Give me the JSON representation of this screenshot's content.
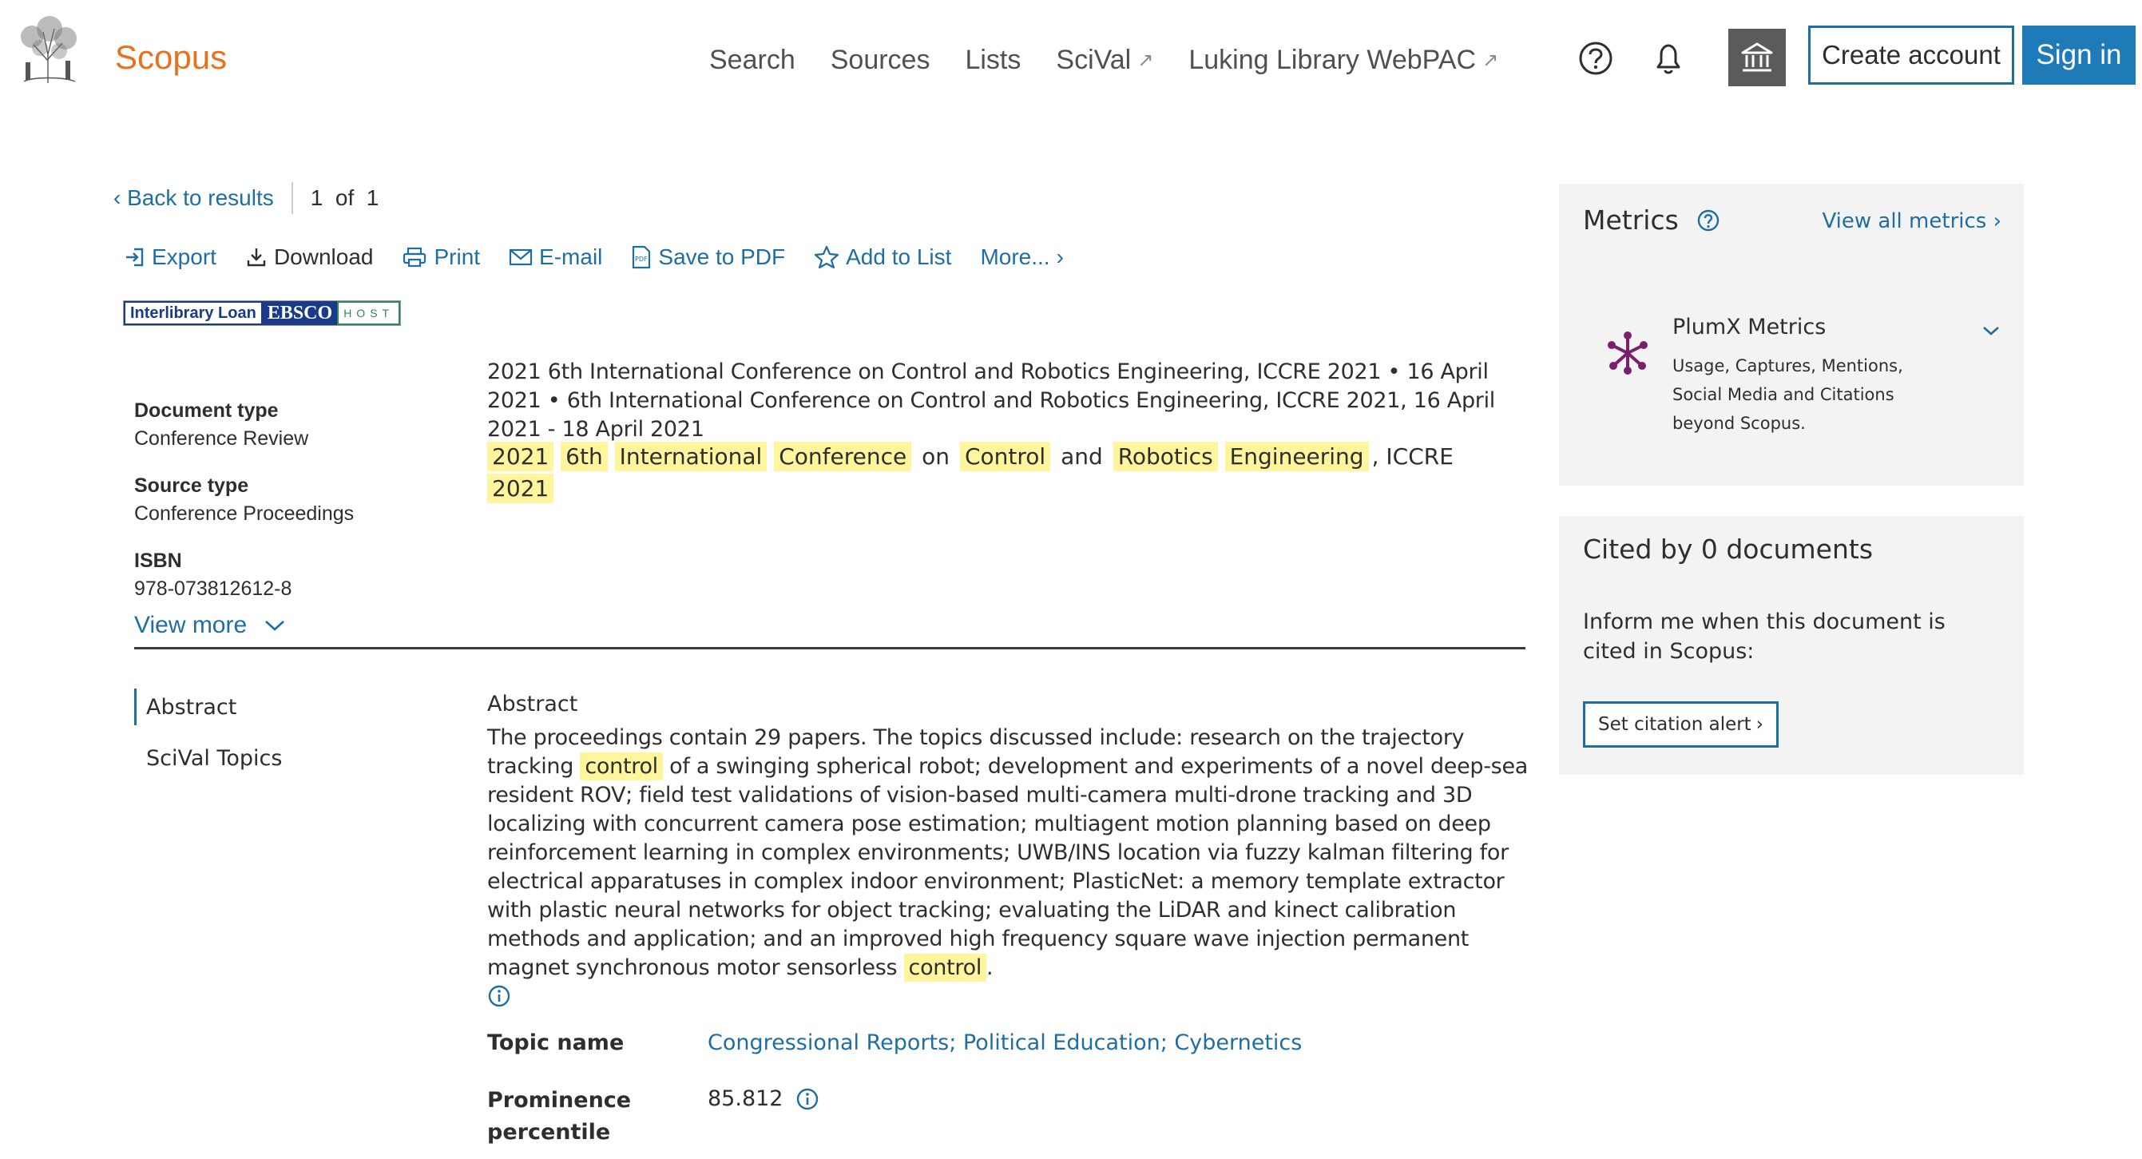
{
  "header": {
    "brand": "Scopus",
    "nav": [
      {
        "label": "Search",
        "external": false
      },
      {
        "label": "Sources",
        "external": false
      },
      {
        "label": "Lists",
        "external": false
      },
      {
        "label": "SciVal",
        "external": true
      },
      {
        "label": "Luking Library WebPAC",
        "external": true
      }
    ],
    "create_account": "Create account",
    "sign_in": "Sign in",
    "icons": [
      "help-icon",
      "bell-icon",
      "institution-icon"
    ]
  },
  "results_nav": {
    "back": "Back to results",
    "position": "1  of  1"
  },
  "actions": {
    "export": "Export",
    "download": "Download",
    "print": "Print",
    "email": "E-mail",
    "save_pdf": "Save to PDF",
    "add_list": "Add to List",
    "more": "More..."
  },
  "links": {
    "interlibrary": "Interlibrary Loan",
    "ebsco": "EBSCO",
    "host": "HOST"
  },
  "meta": {
    "doc_type_label": "Document type",
    "doc_type": "Conference Review",
    "source_type_label": "Source type",
    "source_type": "Conference Proceedings",
    "isbn_label": "ISBN",
    "isbn": "978-073812612-8",
    "view_more": "View more"
  },
  "source": {
    "line": "2021 6th International Conference on Control and Robotics Engineering, ICCRE 2021  •  16 April 2021  •  6th International Conference on Control and Robotics Engineering, ICCRE 2021, 16 April 2021 - 18 April 2021",
    "title_tokens": [
      {
        "t": "2021",
        "hl": true
      },
      {
        "t": "6th",
        "hl": true
      },
      {
        "t": "International",
        "hl": true
      },
      {
        "t": "Conference",
        "hl": true
      },
      {
        "t": "on",
        "hl": false
      },
      {
        "t": "Control",
        "hl": true
      },
      {
        "t": "and",
        "hl": false
      },
      {
        "t": "Robotics",
        "hl": true
      },
      {
        "t": "Engineering",
        "hl": true
      },
      {
        "t": ", ICCRE",
        "hl": false
      },
      {
        "t": "2021",
        "hl": true
      }
    ]
  },
  "tabs": {
    "abstract": "Abstract",
    "scival": "SciVal Topics"
  },
  "abstract": {
    "heading": "Abstract",
    "part1": "The proceedings contain 29 papers. The topics discussed include: research on the trajectory tracking",
    "hl1": "control",
    "part2": "of a swinging spherical robot; development and experiments of a novel deep-sea resident ROV; field test validations of vision-based multi-camera multi-drone tracking and 3D localizing with concurrent camera pose estimation; multiagent motion planning based on deep reinforcement learning in complex environments; UWB/INS location via fuzzy kalman filtering for electrical apparatuses in complex indoor environment; PlasticNet: a memory template extractor with plastic neural networks for object tracking; evaluating the LiDAR and kinect calibration methods and application; and an improved high frequency square wave injection permanent magnet synchronous motor sensorless",
    "hl2": "control",
    "part3": "."
  },
  "topics": {
    "topic_label": "Topic name",
    "topic_value": "Congressional Reports; Political Education; Cybernetics",
    "prominence_label": "Prominence percentile",
    "prominence_value": "85.812"
  },
  "metrics": {
    "title": "Metrics",
    "view_all": "View all metrics",
    "plumx_title": "PlumX Metrics",
    "plumx_desc": "Usage, Captures, Mentions, Social Media and Citations beyond Scopus."
  },
  "cited": {
    "title": "Cited by 0 documents",
    "text": "Inform me when this document is cited in Scopus:",
    "alert": "Set citation alert"
  },
  "colors": {
    "brand": "#e9711c",
    "link": "#1f6ea3",
    "highlight": "#fff59d",
    "signin": "#1f7ab8",
    "plumx": "#7a1f6e"
  }
}
